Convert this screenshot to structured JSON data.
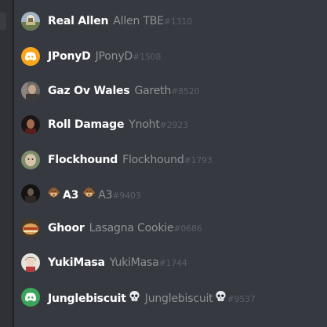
{
  "members": [
    {
      "display_name": "Real Allen",
      "username": "Allen TBE",
      "discriminator": "#1310",
      "avatar": "landscape-avatar"
    },
    {
      "display_name": "JPonyD",
      "username": "JPonyD",
      "discriminator": "#1508",
      "avatar": "discord-default-avatar-orange"
    },
    {
      "display_name": "Gaz Ov Wales",
      "username": "Gareth",
      "discriminator": "#8520",
      "avatar": "portrait-avatar"
    },
    {
      "display_name": "Roll Damage",
      "username": "Ynoht",
      "discriminator": "#2923",
      "avatar": "dark-character-avatar"
    },
    {
      "display_name": "Flockhound",
      "username": "Flockhound",
      "discriminator": "#1793",
      "avatar": "face-avatar"
    },
    {
      "display_name": "A3",
      "username": "A3",
      "discriminator": "#9403",
      "avatar": "dark-figure-avatar",
      "display_emoji": "monkey-emoji",
      "user_emoji": "monkey-emoji"
    },
    {
      "display_name": "Ghoor",
      "username": "Lasagna Cookie",
      "discriminator": "#0686",
      "avatar": "food-avatar"
    },
    {
      "display_name": "YukiMasa",
      "username": "YukiMasa",
      "discriminator": "#1744",
      "avatar": "anime-character-avatar"
    },
    {
      "display_name": "Junglebiscuit",
      "username": "Junglebiscuit",
      "discriminator": "#9537",
      "avatar": "discord-default-avatar-green",
      "display_emoji_after": "skull-emoji",
      "user_emoji_after": "skull-emoji"
    }
  ],
  "colors": {
    "background": "#36393f",
    "display_name": "#ffffff",
    "username": "#8e9297",
    "discriminator": "#5c5f66",
    "discord_orange": "#faa61a",
    "discord_green": "#3ba55c"
  }
}
